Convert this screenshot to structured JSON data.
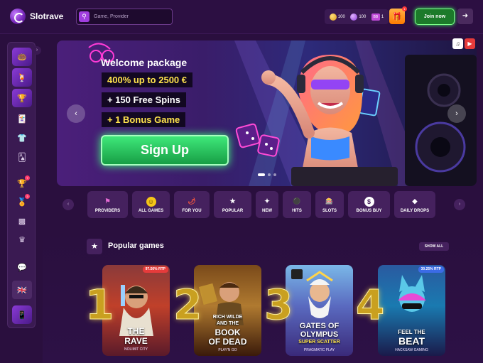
{
  "header": {
    "brand": "Slotrave",
    "search_placeholder": "Game, Provider",
    "balances": [
      {
        "icon": "gold-coin-icon",
        "value": "100"
      },
      {
        "icon": "purple-coin-icon",
        "value": "100"
      },
      {
        "icon": "bonus-bb-icon",
        "label": "BB",
        "value": "1"
      }
    ],
    "gift_badge": "1",
    "join_label": "Join now"
  },
  "sidebar": {
    "items": [
      {
        "icon": "donut-game-icon",
        "type": "game"
      },
      {
        "icon": "cocktail-game-icon",
        "type": "game"
      },
      {
        "icon": "trophy-game-icon",
        "type": "game"
      },
      {
        "icon": "cards-icon"
      },
      {
        "icon": "shirt-icon"
      },
      {
        "icon": "card-stack-icon"
      },
      {
        "icon": "trophy-icon",
        "badge": "7"
      },
      {
        "icon": "medal-icon",
        "badge": "3"
      },
      {
        "icon": "podium-icon"
      },
      {
        "icon": "crown-icon"
      },
      {
        "icon": "chat-icon"
      },
      {
        "icon": "uk-flag-icon"
      },
      {
        "icon": "app-preview-icon"
      }
    ]
  },
  "banner": {
    "title": "Welcome package",
    "line1": "400% up to 2500 €",
    "line2": "+ 150 Free Spins",
    "line3": "+ 1 Bonus Game",
    "cta": "Sign Up",
    "slides": 3,
    "active_slide": 1
  },
  "categories": [
    {
      "label": "PROVIDERS",
      "icon": "flag-icon",
      "color": "#e86bd6"
    },
    {
      "label": "ALL GAMES",
      "icon": "smiley-icon",
      "color": "#f5c518"
    },
    {
      "label": "FOR YOU",
      "icon": "chili-icon",
      "color": "#ff5a3c"
    },
    {
      "label": "POPULAR",
      "icon": "star-icon",
      "color": "#ffffff"
    },
    {
      "label": "NEW",
      "icon": "sparkle-icon",
      "color": "#ffffff"
    },
    {
      "label": "HITS",
      "icon": "joystick-icon",
      "color": "#c04bd8"
    },
    {
      "label": "SLOTS",
      "icon": "slot-machine-icon",
      "color": "#e63b3b"
    },
    {
      "label": "BONUS BUY",
      "icon": "dollar-icon",
      "color": "#ffffff"
    },
    {
      "label": "DAILY DROPS",
      "icon": "drops-icon",
      "color": "#ffffff"
    }
  ],
  "popular": {
    "title": "Popular games",
    "show_all": "SHOW ALL",
    "games": [
      {
        "rank": "1",
        "title_line1": "THE",
        "title_line2": "RAVE",
        "provider": "NOLIMIT CITY",
        "rtp": "97.56% RTP",
        "rtp_color": "#e63b3b"
      },
      {
        "rank": "2",
        "title_line1": "RICH WILDE",
        "title_line2": "AND THE",
        "title_line3": "BOOK",
        "title_line4": "OF DEAD",
        "provider": "PLAY'N GO",
        "rtp": ""
      },
      {
        "rank": "3",
        "title_line1": "GATES OF",
        "title_line2": "OLYMPUS",
        "title_line3": "SUPER SCATTER",
        "provider": "PRAGMATIC PLAY",
        "rtp": ""
      },
      {
        "rank": "4",
        "title_line1": "FEEL THE",
        "title_line2": "BEAT",
        "provider": "HACKSAW GAMING",
        "rtp": "30.25% RTP",
        "rtp_color": "#3b6be6"
      }
    ]
  }
}
